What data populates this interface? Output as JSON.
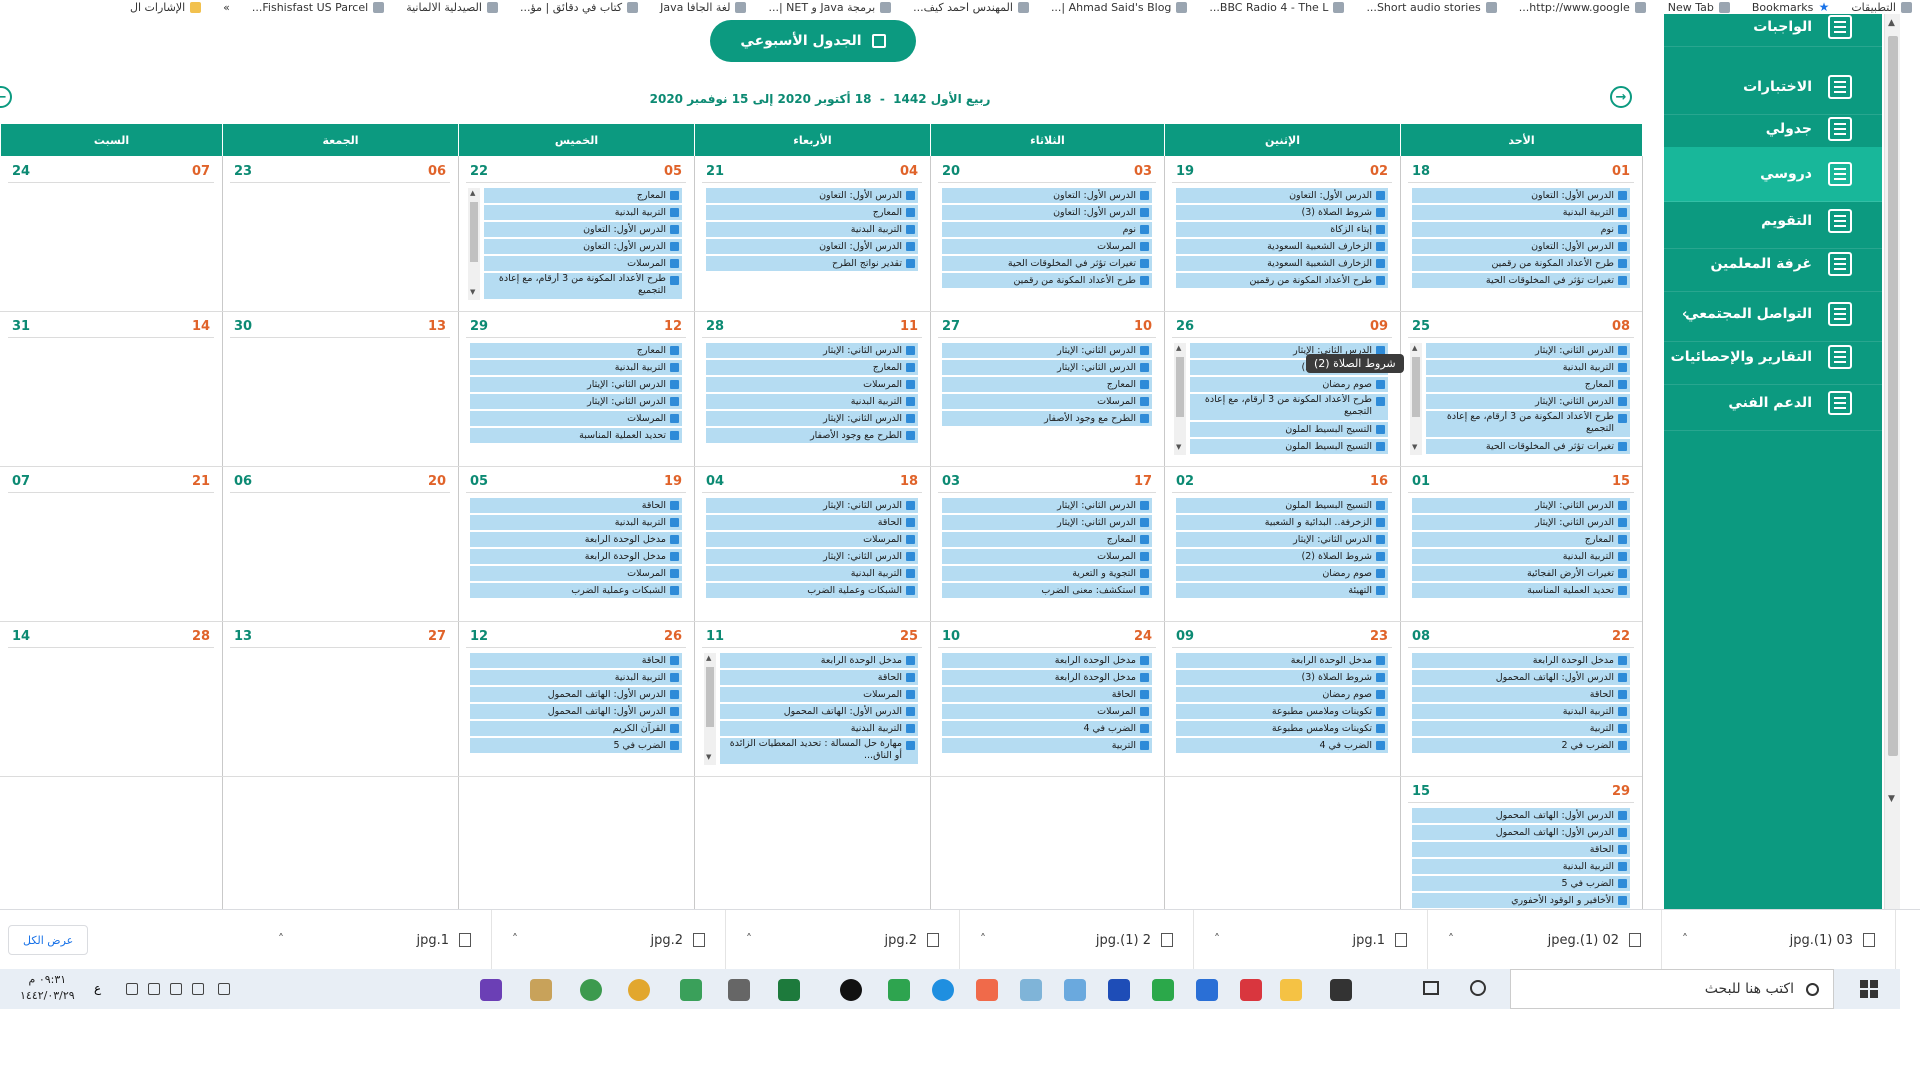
{
  "bookmarks": [
    {
      "label": "التطبيقات",
      "icon": "apps-icon"
    },
    {
      "label": "Bookmarks",
      "icon": "star-icon"
    },
    {
      "label": "New Tab",
      "icon": "newtab-icon"
    },
    {
      "label": "http://www.google...",
      "icon": "google-icon"
    },
    {
      "label": "Short audio stories...",
      "icon": "dna-icon"
    },
    {
      "label": "BBC Radio 4 - The L...",
      "icon": "bbc-icon"
    },
    {
      "label": "Ahmad Said's Blog |...",
      "icon": "page-icon"
    },
    {
      "label": "المهندس احمد كيف...",
      "icon": "page-icon"
    },
    {
      "label": "برمجة Java و NET |...",
      "icon": "java-icon"
    },
    {
      "label": "لغة الجافا Java",
      "icon": "java-icon"
    },
    {
      "label": "كتاب في دقائق | مؤ...",
      "icon": "book-icon"
    },
    {
      "label": "الصيدلية الالمانية",
      "icon": "pharmacy-icon"
    },
    {
      "label": "Fishisfast US Parcel...",
      "icon": "fish-icon"
    },
    {
      "label": "»",
      "icon": ""
    },
    {
      "label": "الإشارات ال",
      "icon": "folder-icon"
    }
  ],
  "sidebar": {
    "items": [
      {
        "label": "الواجبات",
        "icon": "homework-icon"
      },
      {
        "label": "الاختبارات",
        "icon": "test-icon"
      },
      {
        "label": "جدولي",
        "icon": "schedule-icon"
      },
      {
        "label": "دروسي",
        "icon": "lessons-icon"
      },
      {
        "label": "التقويم",
        "icon": "calendar-icon"
      },
      {
        "label": "غرفة المعلمين",
        "icon": "teacher-icon"
      },
      {
        "label": "التواصل المجتمعي",
        "icon": "community-icon"
      },
      {
        "label": "التقارير والإحصائيات",
        "icon": "reports-icon"
      },
      {
        "label": "الدعم الفني",
        "icon": "support-icon"
      }
    ],
    "active_index": 3
  },
  "header": {
    "weekly_button": "الجدول الأسبوعي",
    "hijri": "ربيع الأول 1442",
    "range": "18 أكتوبر 2020 إلى 15 نوفمبر 2020",
    "prev_icon": "arrow-left-circle-icon",
    "next_icon": "arrow-right-circle-icon"
  },
  "calendar": {
    "day_headers": [
      "الأحد",
      "الإثنين",
      "الثلاثاء",
      "الأربعاء",
      "الخميس",
      "الجمعة",
      "السبت"
    ],
    "weeks": [
      [
        {
          "r": "01",
          "l": "18",
          "events": [
            "الدرس الأول: التعاون",
            "التربية البدنية",
            "نوم",
            "الدرس الأول: التعاون",
            "طرح الأعداد المكونة من رقمين",
            "تغيرات تؤثر في المخلوقات الحية"
          ]
        },
        {
          "r": "02",
          "l": "19",
          "events": [
            "الدرس الأول: التعاون",
            "شروط الصلاة (3)",
            "إيتاء الزكاة",
            "الزخارف الشعبية السعودية",
            "الزخارف الشعبية السعودية",
            "طرح الأعداد المكونة من رقمين"
          ]
        },
        {
          "r": "03",
          "l": "20",
          "events": [
            "الدرس الأول: التعاون",
            "الدرس الأول: التعاون",
            "نوم",
            "المرسلات",
            "تغيرات تؤثر في المخلوقات الحية",
            "طرح الأعداد المكونة من رقمين"
          ]
        },
        {
          "r": "04",
          "l": "21",
          "events": [
            "الدرس الأول: التعاون",
            "المعارج",
            "التربية البدنية",
            "الدرس الأول: التعاون",
            "تقدير نواتج الطرح"
          ]
        },
        {
          "r": "05",
          "l": "22",
          "scroll": true,
          "events": [
            "المعارج",
            "التربية البدنية",
            "الدرس الأول: التعاون",
            "الدرس الأول: التعاون",
            "المرسلات",
            "طرح الأعداد المكونة من 3 أرقام، مع إعادة التجميع"
          ]
        },
        {
          "r": "06",
          "l": "23",
          "events": []
        },
        {
          "r": "07",
          "l": "24",
          "events": []
        }
      ],
      [
        {
          "r": "08",
          "l": "25",
          "scroll": true,
          "events": [
            "الدرس الثاني: الإيثار",
            "التربية البدنية",
            "المعارج",
            "الدرس الثاني: الإيثار",
            "طرح الأعداد المكونة من 3 أرقام، مع إعادة التجميع",
            "تغيرات تؤثر في المخلوقات الحية"
          ]
        },
        {
          "r": "09",
          "l": "26",
          "scroll": true,
          "events": [
            "الدرس الثاني: الإيثار",
            "شروط الصلاة (2)",
            "صوم رمضان",
            "طرح الأعداد المكونة من 3 أرقام، مع إعادة التجميع",
            "التسيج البسيط الملون",
            "التسيج البسيط الملون"
          ]
        },
        {
          "r": "10",
          "l": "27",
          "events": [
            "الدرس الثاني: الإيثار",
            "الدرس الثاني: الإيثار",
            "المعارج",
            "المرسلات",
            "الطرح مع وجود الأصفار"
          ]
        },
        {
          "r": "11",
          "l": "28",
          "events": [
            "الدرس الثاني: الإيثار",
            "المعارج",
            "المرسلات",
            "التربية البدنية",
            "الدرس الثاني: الإيثار",
            "الطرح مع وجود الأصفار"
          ]
        },
        {
          "r": "12",
          "l": "29",
          "events": [
            "المعارج",
            "التربية البدنية",
            "الدرس الثاني: الإيثار",
            "الدرس الثاني: الإيثار",
            "المرسلات",
            "تحديد العملية المناسبة"
          ]
        },
        {
          "r": "13",
          "l": "30",
          "events": []
        },
        {
          "r": "14",
          "l": "31",
          "events": []
        }
      ],
      [
        {
          "r": "15",
          "l": "01",
          "events": [
            "الدرس الثاني: الإيثار",
            "الدرس الثاني: الإيثار",
            "المعارج",
            "التربية البدنية",
            "تغيرات الأرض الفجائية",
            "تحديد العملية المناسبة"
          ]
        },
        {
          "r": "16",
          "l": "02",
          "events": [
            "التسيج البسيط الملون",
            "الزخرفة.. البدائية و الشعبية",
            "الدرس الثاني: الإيثار",
            "شروط الصلاة (2)",
            "صوم رمضان",
            "التهيئة"
          ]
        },
        {
          "r": "17",
          "l": "03",
          "events": [
            "الدرس الثاني: الإيثار",
            "الدرس الثاني: الإيثار",
            "المعارج",
            "المرسلات",
            "التجوية و التعرية",
            "استكشف: معنى الضرب"
          ]
        },
        {
          "r": "18",
          "l": "04",
          "events": [
            "الدرس الثاني: الإيثار",
            "الحاقة",
            "المرسلات",
            "الدرس الثاني: الإيثار",
            "التربية البدنية",
            "الشبكات وعملية الضرب"
          ]
        },
        {
          "r": "19",
          "l": "05",
          "events": [
            "الحاقة",
            "التربية البدنية",
            "مدخل الوحدة الرابعة",
            "مدخل الوحدة الرابعة",
            "المرسلات",
            "الشبكات وعملية الضرب"
          ]
        },
        {
          "r": "20",
          "l": "06",
          "events": []
        },
        {
          "r": "21",
          "l": "07",
          "events": []
        }
      ],
      [
        {
          "r": "22",
          "l": "08",
          "events": [
            "مدخل الوحدة الرابعة",
            "الدرس الأول: الهاتف المحمول",
            "الحاقة",
            "التربية البدنية",
            "التربية",
            "الضرب في 2"
          ]
        },
        {
          "r": "23",
          "l": "09",
          "events": [
            "مدخل الوحدة الرابعة",
            "شروط الصلاة (3)",
            "صوم رمضان",
            "تكوينات وملامس مطبوعة",
            "تكوينات وملامس مطبوعة",
            "الضرب في 4"
          ]
        },
        {
          "r": "24",
          "l": "10",
          "events": [
            "مدخل الوحدة الرابعة",
            "مدخل الوحدة الرابعة",
            "الحاقة",
            "المرسلات",
            "الضرب في 4",
            "التربية"
          ]
        },
        {
          "r": "25",
          "l": "11",
          "scroll": true,
          "events": [
            "مدخل الوحدة الرابعة",
            "الحاقة",
            "المرسلات",
            "الدرس الأول: الهاتف المحمول",
            "التربية البدنية",
            "مهارة حل المسألة : تحديد المعطيات الزائدة أو الناق..."
          ]
        },
        {
          "r": "26",
          "l": "12",
          "events": [
            "الحاقة",
            "التربية البدنية",
            "الدرس الأول: الهاتف المحمول",
            "الدرس الأول: الهاتف المحمول",
            "القرآن الكريم",
            "الضرب في 5"
          ]
        },
        {
          "r": "27",
          "l": "13",
          "events": []
        },
        {
          "r": "28",
          "l": "14",
          "events": []
        }
      ],
      [
        {
          "r": "29",
          "l": "15",
          "events": [
            "الدرس الأول: الهاتف المحمول",
            "الدرس الأول: الهاتف المحمول",
            "الحاقة",
            "التربية البدنية",
            "الضرب في 5",
            "الأخافير و الوقود الأحفوري"
          ]
        },
        {
          "r": "",
          "l": "",
          "events": []
        },
        {
          "r": "",
          "l": "",
          "events": []
        },
        {
          "r": "",
          "l": "",
          "events": []
        },
        {
          "r": "",
          "l": "",
          "events": []
        },
        {
          "r": "",
          "l": "",
          "events": []
        },
        {
          "r": "",
          "l": "",
          "events": []
        }
      ]
    ],
    "tooltip": "شروط الصلاة (2)"
  },
  "downloads": {
    "items": [
      "03 (1).jpg",
      "02 (1).jpeg",
      "1.jpg",
      "2 (1).jpg",
      "2.jpg",
      "2.jpg",
      "1.jpg"
    ],
    "show_all": "عرض الكل"
  },
  "taskbar": {
    "search_placeholder": "اكتب هنا للبحث",
    "time": "٠٩:٣١ م",
    "date": "١٤٤٢/٠٣/٢٩",
    "lang": "ع"
  },
  "colors": {
    "accent": "#0c9a80",
    "event_bg": "#b5dcf2",
    "date_right": "#e0632a",
    "date_left": "#0c8a73"
  }
}
